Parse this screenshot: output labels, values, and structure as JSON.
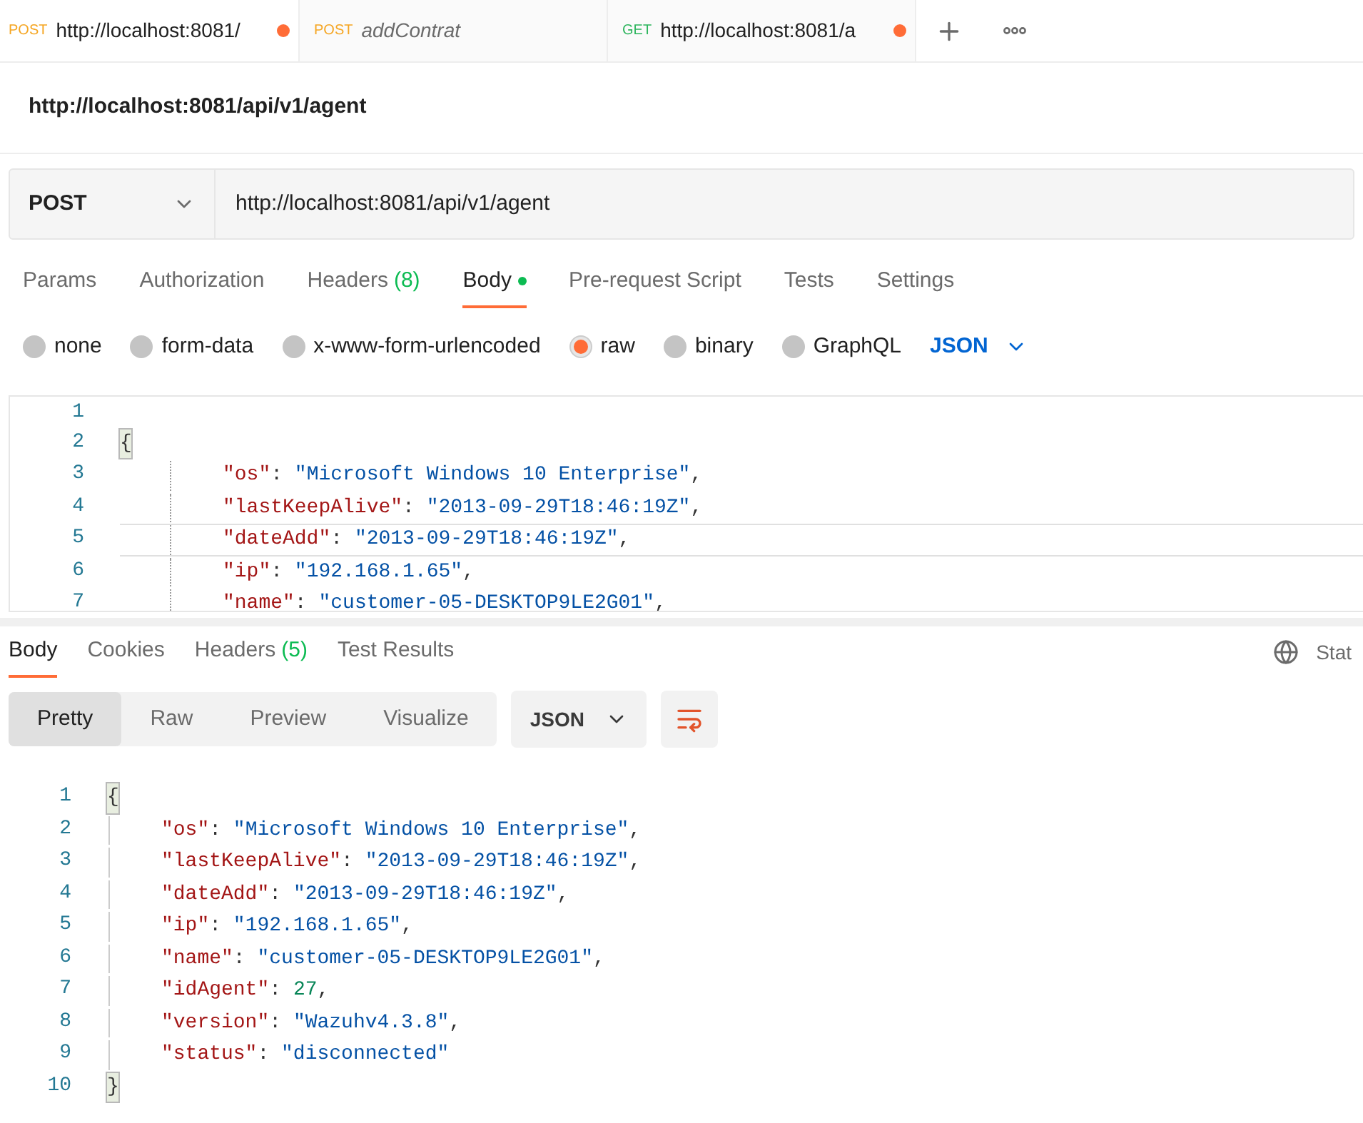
{
  "request_tabs": [
    {
      "method": "POST",
      "color": "#f5a623",
      "title": "http://localhost:8081/",
      "italic": false,
      "unsaved": true,
      "selected": true
    },
    {
      "method": "POST",
      "color": "#f5a623",
      "title": "addContrat",
      "italic": true,
      "unsaved": false,
      "selected": false
    },
    {
      "method": "GET",
      "color": "#2db55d",
      "title": "http://localhost:8081/a",
      "italic": false,
      "unsaved": true,
      "selected": false
    }
  ],
  "request_title": "http://localhost:8081/api/v1/agent",
  "url_bar": {
    "method": "POST",
    "url": "http://localhost:8081/api/v1/agent"
  },
  "request_sections": [
    {
      "label": "Params",
      "selected": false
    },
    {
      "label": "Authorization",
      "selected": false
    },
    {
      "label": "Headers",
      "count": "(8)",
      "selected": false
    },
    {
      "label": "Body",
      "dot": true,
      "selected": true
    },
    {
      "label": "Pre-request Script",
      "selected": false
    },
    {
      "label": "Tests",
      "selected": false
    },
    {
      "label": "Settings",
      "selected": false
    }
  ],
  "body_types": [
    {
      "label": "none",
      "selected": false
    },
    {
      "label": "form-data",
      "selected": false
    },
    {
      "label": "x-www-form-urlencoded",
      "selected": false
    },
    {
      "label": "raw",
      "selected": true
    },
    {
      "label": "binary",
      "selected": false
    },
    {
      "label": "GraphQL",
      "selected": false
    }
  ],
  "body_format": "JSON",
  "request_editor": [
    {
      "number": "1",
      "active": false
    },
    {
      "number": "2",
      "active": false,
      "tokens": [
        {
          "kind": "bracket",
          "text": "{"
        }
      ]
    },
    {
      "number": "3",
      "active": false,
      "indent": true,
      "tokens": [
        {
          "kind": "key",
          "text": "\"os\""
        },
        {
          "kind": "punct",
          "text": ": "
        },
        {
          "kind": "string",
          "text": "\"Microsoft Windows 10 Enterprise\""
        },
        {
          "kind": "punct",
          "text": ","
        }
      ]
    },
    {
      "number": "4",
      "active": false,
      "indent": true,
      "tokens": [
        {
          "kind": "key",
          "text": "\"lastKeepAlive\""
        },
        {
          "kind": "punct",
          "text": ": "
        },
        {
          "kind": "string",
          "text": "\"2013-09-29T18:46:19Z\""
        },
        {
          "kind": "punct",
          "text": ","
        }
      ]
    },
    {
      "number": "5",
      "active": true,
      "indent": true,
      "tokens": [
        {
          "kind": "key",
          "text": "\"dateAdd\""
        },
        {
          "kind": "punct",
          "text": ": "
        },
        {
          "kind": "string",
          "text": "\"2013-09-29T18:46:19Z\""
        },
        {
          "kind": "punct",
          "text": ","
        }
      ]
    },
    {
      "number": "6",
      "active": false,
      "indent": true,
      "tokens": [
        {
          "kind": "key",
          "text": "\"ip\""
        },
        {
          "kind": "punct",
          "text": ": "
        },
        {
          "kind": "string",
          "text": "\"192.168.1.65\""
        },
        {
          "kind": "punct",
          "text": ","
        }
      ]
    },
    {
      "number": "7",
      "active": false,
      "indent": true,
      "tokens": [
        {
          "kind": "key",
          "text": "\"name\""
        },
        {
          "kind": "punct",
          "text": ": "
        },
        {
          "kind": "string",
          "text": "\"customer-05-DESKTOP9LE2G01\""
        },
        {
          "kind": "punct",
          "text": ","
        }
      ]
    }
  ],
  "response_sections": [
    {
      "label": "Body",
      "selected": true
    },
    {
      "label": "Cookies",
      "selected": false
    },
    {
      "label": "Headers",
      "count": "(5)",
      "selected": false
    },
    {
      "label": "Test Results",
      "selected": false
    }
  ],
  "response_status": "Stat",
  "view_modes": [
    {
      "label": "Pretty",
      "selected": true
    },
    {
      "label": "Raw",
      "selected": false
    },
    {
      "label": "Preview",
      "selected": false
    },
    {
      "label": "Visualize",
      "selected": false
    }
  ],
  "response_format": "JSON",
  "response_body": [
    {
      "number": "1",
      "tokens": [
        {
          "kind": "bracket",
          "text": "{"
        }
      ]
    },
    {
      "number": "2",
      "indent": true,
      "tokens": [
        {
          "kind": "key",
          "text": "\"os\""
        },
        {
          "kind": "punct",
          "text": ": "
        },
        {
          "kind": "string",
          "text": "\"Microsoft Windows 10 Enterprise\""
        },
        {
          "kind": "punct",
          "text": ","
        }
      ]
    },
    {
      "number": "3",
      "indent": true,
      "tokens": [
        {
          "kind": "key",
          "text": "\"lastKeepAlive\""
        },
        {
          "kind": "punct",
          "text": ": "
        },
        {
          "kind": "string",
          "text": "\"2013-09-29T18:46:19Z\""
        },
        {
          "kind": "punct",
          "text": ","
        }
      ]
    },
    {
      "number": "4",
      "indent": true,
      "tokens": [
        {
          "kind": "key",
          "text": "\"dateAdd\""
        },
        {
          "kind": "punct",
          "text": ": "
        },
        {
          "kind": "string",
          "text": "\"2013-09-29T18:46:19Z\""
        },
        {
          "kind": "punct",
          "text": ","
        }
      ]
    },
    {
      "number": "5",
      "indent": true,
      "tokens": [
        {
          "kind": "key",
          "text": "\"ip\""
        },
        {
          "kind": "punct",
          "text": ": "
        },
        {
          "kind": "string",
          "text": "\"192.168.1.65\""
        },
        {
          "kind": "punct",
          "text": ","
        }
      ]
    },
    {
      "number": "6",
      "indent": true,
      "tokens": [
        {
          "kind": "key",
          "text": "\"name\""
        },
        {
          "kind": "punct",
          "text": ": "
        },
        {
          "kind": "string",
          "text": "\"customer-05-DESKTOP9LE2G01\""
        },
        {
          "kind": "punct",
          "text": ","
        }
      ]
    },
    {
      "number": "7",
      "indent": true,
      "tokens": [
        {
          "kind": "key",
          "text": "\"idAgent\""
        },
        {
          "kind": "punct",
          "text": ": "
        },
        {
          "kind": "number",
          "text": "27"
        },
        {
          "kind": "punct",
          "text": ","
        }
      ]
    },
    {
      "number": "8",
      "indent": true,
      "tokens": [
        {
          "kind": "key",
          "text": "\"version\""
        },
        {
          "kind": "punct",
          "text": ": "
        },
        {
          "kind": "string",
          "text": "\"Wazuhv4.3.8\""
        },
        {
          "kind": "punct",
          "text": ","
        }
      ]
    },
    {
      "number": "9",
      "indent": true,
      "tokens": [
        {
          "kind": "key",
          "text": "\"status\""
        },
        {
          "kind": "punct",
          "text": ": "
        },
        {
          "kind": "string",
          "text": "\"disconnected\""
        }
      ]
    },
    {
      "number": "10",
      "tokens": [
        {
          "kind": "bracket",
          "text": "}"
        }
      ]
    }
  ]
}
